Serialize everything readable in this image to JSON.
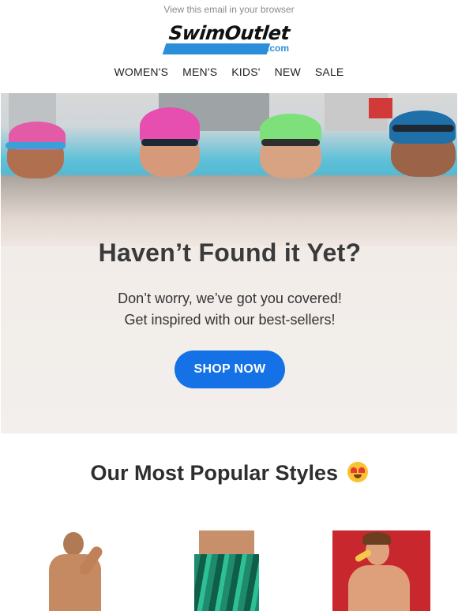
{
  "header": {
    "view_browser": "View this email in your browser",
    "logo_text": "SwimOutlet",
    "logo_suffix": ".com"
  },
  "nav": {
    "items": [
      {
        "label": "WOMEN'S"
      },
      {
        "label": "MEN'S"
      },
      {
        "label": "KIDS'"
      },
      {
        "label": "NEW"
      },
      {
        "label": "SALE"
      }
    ]
  },
  "hero": {
    "title": "Haven’t Found it Yet?",
    "line1": "Don’t worry, we’ve got you covered!",
    "line2": "Get inspired with our best-sellers!",
    "cta": "SHOP NOW"
  },
  "popular": {
    "title": "Our Most Popular Styles",
    "emoji": "heart-eyes-emoji"
  },
  "colors": {
    "accent": "#1472e6",
    "brand_blue": "#2a8fd8"
  }
}
